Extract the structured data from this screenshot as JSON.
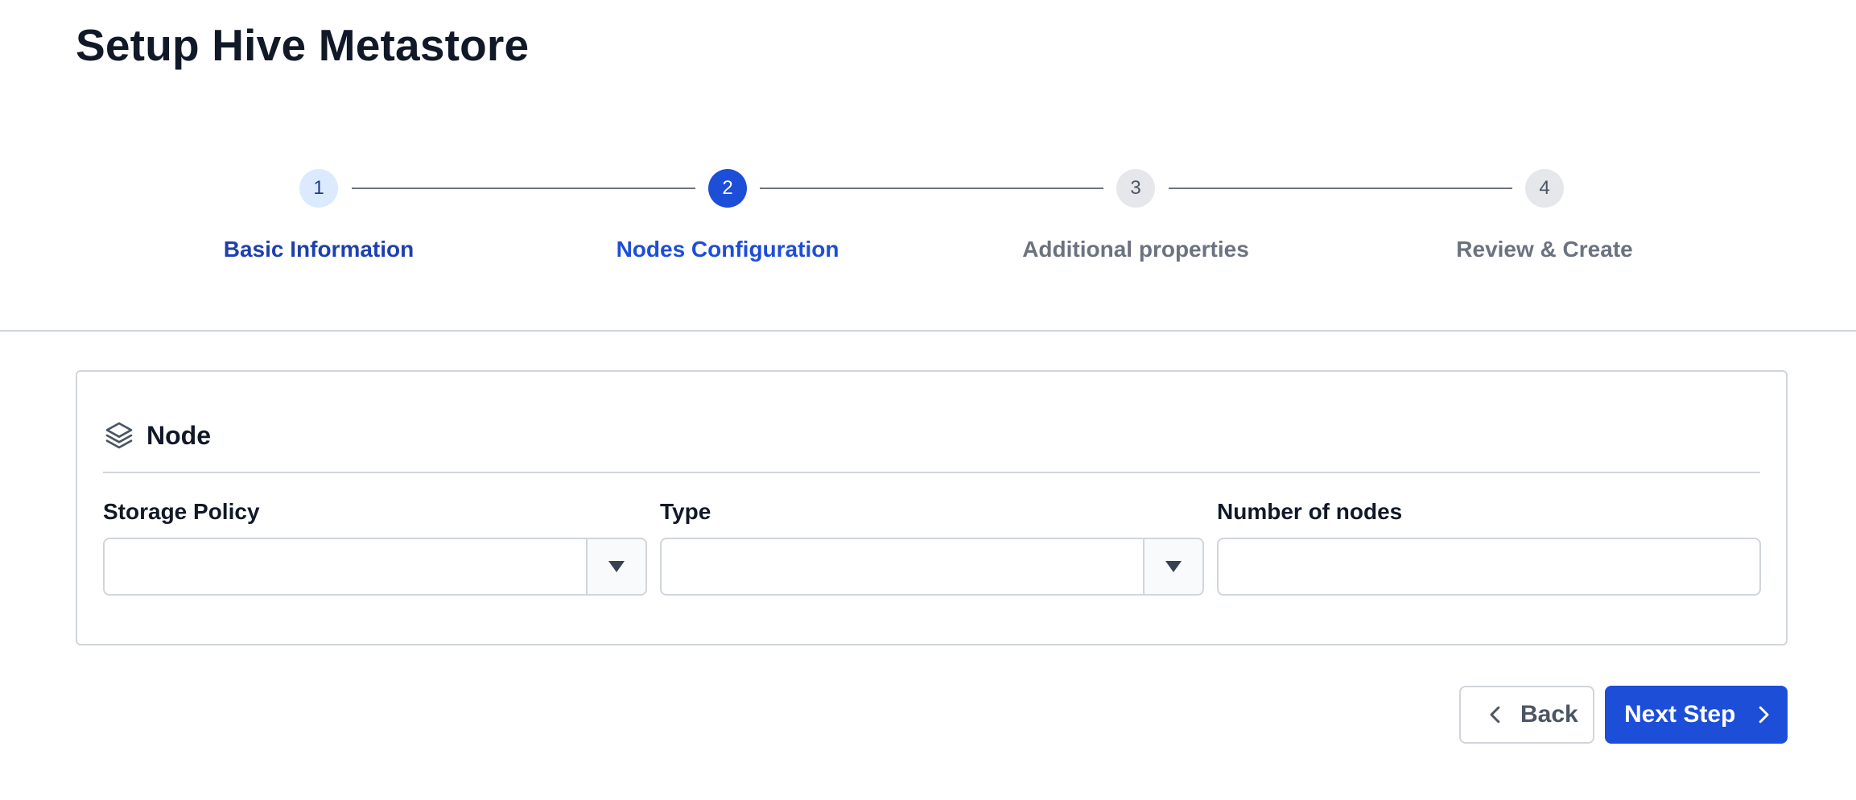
{
  "page": {
    "title": "Setup Hive Metastore"
  },
  "stepper": {
    "steps": [
      {
        "number": "1",
        "label": "Basic Information",
        "status": "completed"
      },
      {
        "number": "2",
        "label": "Nodes Configuration",
        "status": "active"
      },
      {
        "number": "3",
        "label": "Additional properties",
        "status": "upcoming"
      },
      {
        "number": "4",
        "label": "Review & Create",
        "status": "upcoming"
      }
    ]
  },
  "card": {
    "title": "Node",
    "icon": "layers-icon",
    "fields": {
      "storage_policy": {
        "label": "Storage Policy",
        "value": ""
      },
      "type": {
        "label": "Type",
        "value": ""
      },
      "number_of_nodes": {
        "label": "Number of nodes",
        "value": ""
      }
    }
  },
  "actions": {
    "back_label": "Back",
    "next_label": "Next Step"
  },
  "colors": {
    "primary": "#1d4ed8",
    "completed_step_bg": "#dbeafe",
    "upcoming_step_bg": "#e5e7eb",
    "border": "#d1d5db",
    "text": "#111827",
    "muted_text": "#6b7280"
  }
}
